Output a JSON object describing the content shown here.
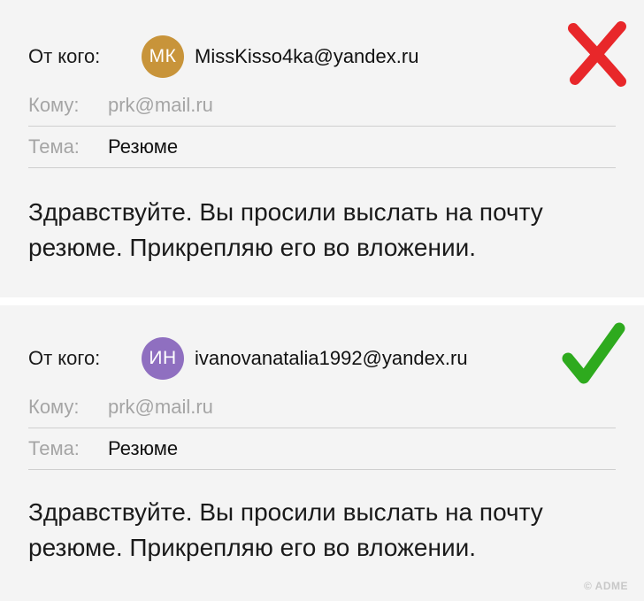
{
  "emails": [
    {
      "from_label": "От кого:",
      "avatar_initials": "МК",
      "avatar_color": "#c8943a",
      "sender": "MissKisso4ka@yandex.ru",
      "to_label": "Кому:",
      "to_value": "prk@mail.ru",
      "subject_label": "Тема:",
      "subject_value": "Резюме",
      "body_line1": "Здравствуйте. Вы просили выслать на почту",
      "body_line2": "резюме. Прикрепляю его во вложении.",
      "verdict_icon": "cross-icon",
      "verdict_color": "#e8272a"
    },
    {
      "from_label": "От кого:",
      "avatar_initials": "ИН",
      "avatar_color": "#8f6fc0",
      "sender": "ivanovanatalia1992@yandex.ru",
      "to_label": "Кому:",
      "to_value": "prk@mail.ru",
      "subject_label": "Тема:",
      "subject_value": "Резюме",
      "body_line1": "Здравствуйте. Вы просили выслать на почту",
      "body_line2": "резюме. Прикрепляю его во вложении.",
      "verdict_icon": "checkmark-icon",
      "verdict_color": "#2eaa1e"
    }
  ],
  "watermark": "© ADME"
}
